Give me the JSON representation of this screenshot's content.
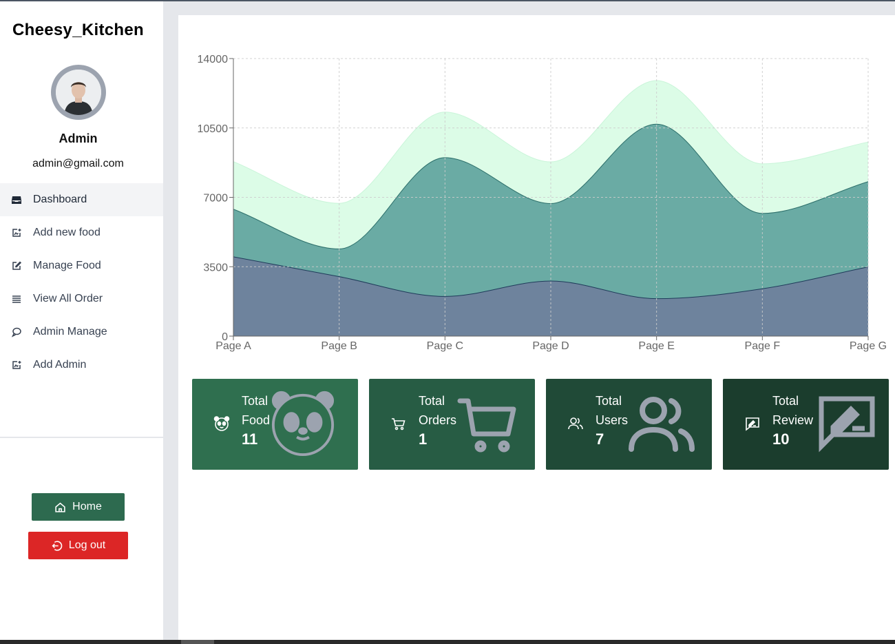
{
  "app": {
    "brand": "Cheesy_Kitchen"
  },
  "profile": {
    "name": "Admin",
    "email": "admin@gmail.com"
  },
  "sidebar": {
    "items": [
      {
        "label": "Dashboard",
        "icon": "inbox-icon",
        "active": true
      },
      {
        "label": "Add new food",
        "icon": "add-image-icon"
      },
      {
        "label": "Manage Food",
        "icon": "edit-icon"
      },
      {
        "label": "View All Order",
        "icon": "list-icon"
      },
      {
        "label": "Admin Manage",
        "icon": "chat-icon"
      },
      {
        "label": "Add Admin",
        "icon": "add-image-icon"
      }
    ],
    "home_label": "Home",
    "logout_label": "Log out"
  },
  "colors": {
    "sidebar_bg": "#ffffff",
    "brand_green": "#2d6a4f",
    "danger_red": "#dc2626",
    "series_light": "#dcfce7",
    "series_mid": "#6aaba4",
    "series_dark": "#6e839d"
  },
  "stats": [
    {
      "label_line1": "Total",
      "label_line2": "Food",
      "value": "11",
      "icon": "panda-icon",
      "bg": "#2f6f4f"
    },
    {
      "label_line1": "Total",
      "label_line2": "Orders",
      "value": "1",
      "icon": "cart-icon",
      "bg": "#275c44"
    },
    {
      "label_line1": "Total",
      "label_line2": "Users",
      "value": "7",
      "icon": "users-icon",
      "bg": "#204a37"
    },
    {
      "label_line1": "Total",
      "label_line2": "Review",
      "value": "10",
      "icon": "review-icon",
      "bg": "#1b3d2d"
    }
  ],
  "chart_data": {
    "type": "area",
    "stacked": true,
    "categories": [
      "Page A",
      "Page B",
      "Page C",
      "Page D",
      "Page E",
      "Page F",
      "Page G"
    ],
    "ylim": [
      0,
      14000
    ],
    "yticks": [
      0,
      3500,
      7000,
      10500,
      14000
    ],
    "grid": true,
    "series": [
      {
        "values": [
          4000,
          3000,
          2000,
          2780,
          1890,
          2390,
          3490
        ],
        "color": "#6e839d",
        "stroke": "#1f3b5a"
      },
      {
        "values": [
          2400,
          1398,
          7000,
          3908,
          8800,
          3800,
          4300
        ],
        "color": "#6aaba4",
        "stroke": "#2c6e6a"
      },
      {
        "values": [
          2400,
          2300,
          2300,
          2100,
          2200,
          2500,
          2000
        ],
        "color": "#dcfce7",
        "stroke": "#c9f5d9"
      }
    ]
  }
}
